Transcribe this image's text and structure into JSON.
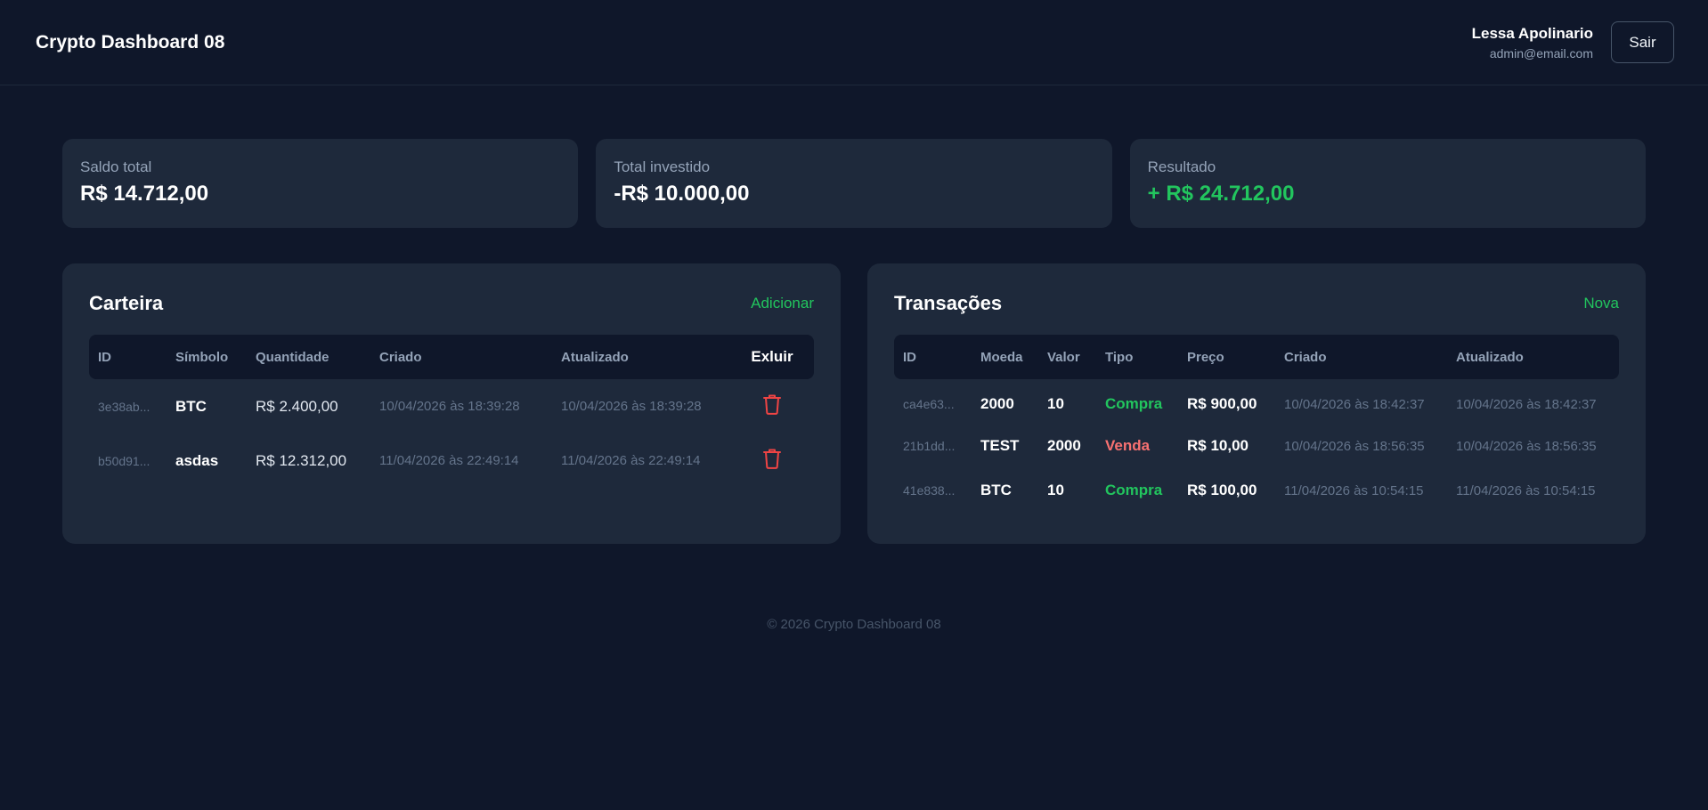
{
  "header": {
    "title": "Crypto Dashboard 08",
    "user_name": "Lessa Apolinario",
    "user_email": "admin@email.com",
    "logout_label": "Sair"
  },
  "stats": [
    {
      "label": "Saldo total",
      "value": "R$ 14.712,00"
    },
    {
      "label": "Total investido",
      "value": "-R$ 10.000,00"
    },
    {
      "label": "Resultado",
      "value": "+ R$ 24.712,00"
    }
  ],
  "wallet": {
    "title": "Carteira",
    "action_label": "Adicionar",
    "columns": [
      "ID",
      "Símbolo",
      "Quantidade",
      "Criado",
      "Atualizado",
      "Exluir"
    ],
    "rows": [
      {
        "id": "3e38ab...",
        "symbol": "BTC",
        "quantity": "R$ 2.400,00",
        "created": "10/04/2026 às 18:39:28",
        "updated": "10/04/2026 às 18:39:28",
        "delete_icon": "trash-icon"
      },
      {
        "id": "b50d91...",
        "symbol": "asdas",
        "quantity": "R$ 12.312,00",
        "created": "11/04/2026 às 22:49:14",
        "updated": "11/04/2026 às 22:49:14",
        "delete_icon": "trash-icon"
      }
    ]
  },
  "transactions": {
    "title": "Transações",
    "action_label": "Nova",
    "columns": [
      "ID",
      "Moeda",
      "Valor",
      "Tipo",
      "Preço",
      "Criado",
      "Atualizado"
    ],
    "rows": [
      {
        "id": "ca4e63...",
        "coin": "2000",
        "amount": "10",
        "type": "Compra",
        "price": "R$ 900,00",
        "created": "10/04/2026 às 18:42:37",
        "updated": "10/04/2026 às 18:42:37"
      },
      {
        "id": "21b1dd...",
        "coin": "TEST",
        "amount": "2000",
        "type": "Venda",
        "price": "R$ 10,00",
        "created": "10/04/2026 às 18:56:35",
        "updated": "10/04/2026 às 18:56:35"
      },
      {
        "id": "41e838...",
        "coin": "BTC",
        "amount": "10",
        "type": "Compra",
        "price": "R$ 100,00",
        "created": "11/04/2026 às 10:54:15",
        "updated": "11/04/2026 às 10:54:15"
      }
    ]
  },
  "footer": {
    "text": "© 2026 Crypto Dashboard 08"
  },
  "colors": {
    "background": "#0f172a",
    "card": "#1e293b",
    "positive": "#22c55e",
    "negative": "#f87171",
    "danger_icon": "#ef4444"
  }
}
